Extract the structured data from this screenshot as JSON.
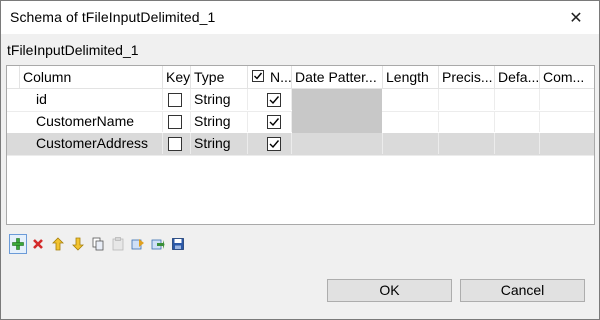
{
  "window": {
    "title": "Schema of tFileInputDelimited_1",
    "close_glyph": "✕"
  },
  "subtitle": "tFileInputDelimited_1",
  "table": {
    "columns": [
      "Column",
      "Key",
      "Type",
      "N...",
      "Date Patter...",
      "Length",
      "Precis...",
      "Defa...",
      "Com..."
    ],
    "nullable_header_checked": true,
    "rows": [
      {
        "column": "id",
        "key": false,
        "type": "String",
        "nullable": true
      },
      {
        "column": "CustomerName",
        "key": false,
        "type": "String",
        "nullable": true
      },
      {
        "column": "CustomerAddress",
        "key": false,
        "type": "String",
        "nullable": true
      }
    ],
    "selected_row": 2
  },
  "toolbar": {
    "icons": [
      "add-icon",
      "remove-icon",
      "move-up-icon",
      "move-down-icon",
      "copy-icon",
      "paste-icon",
      "import-icon",
      "export-icon",
      "save-icon"
    ]
  },
  "buttons": {
    "ok": "OK",
    "cancel": "Cancel"
  }
}
